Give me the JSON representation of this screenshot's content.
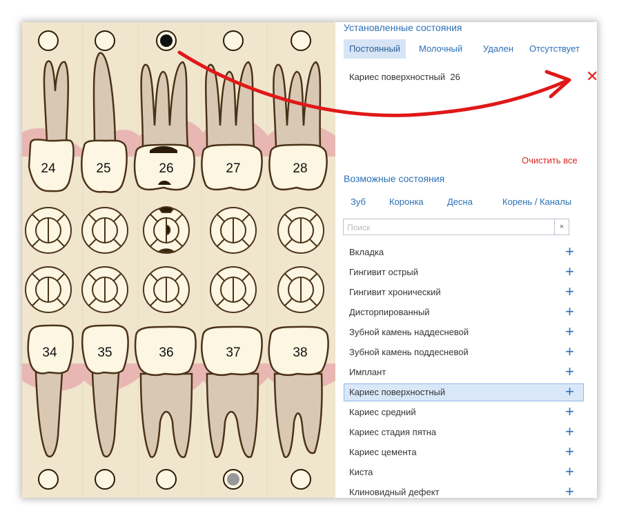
{
  "installed": {
    "title": "Установленные состояния",
    "tabs": [
      {
        "label": "Постоянный",
        "active": true
      },
      {
        "label": "Молочный",
        "active": false
      },
      {
        "label": "Удален",
        "active": false
      },
      {
        "label": "Отсутствует",
        "active": false
      }
    ],
    "conditions": [
      {
        "name": "Кариес поверхностный",
        "tooth": "26"
      }
    ],
    "clear_all_label": "Очистить все"
  },
  "possible": {
    "title": "Возможные состояния",
    "tabs": [
      {
        "label": "Зуб"
      },
      {
        "label": "Коронка"
      },
      {
        "label": "Десна"
      },
      {
        "label": "Корень / Каналы"
      }
    ],
    "search_placeholder": "Поиск",
    "search_clear_label": "×",
    "items": [
      {
        "label": "Вкладка",
        "selected": false
      },
      {
        "label": "Гингивит острый",
        "selected": false
      },
      {
        "label": "Гингивит хронический",
        "selected": false
      },
      {
        "label": "Дисторпированный",
        "selected": false
      },
      {
        "label": "Зубной камень наддесневой",
        "selected": false
      },
      {
        "label": "Зубной камень поддесневой",
        "selected": false
      },
      {
        "label": "Имплант",
        "selected": false
      },
      {
        "label": "Кариес поверхностный",
        "selected": true
      },
      {
        "label": "Кариес средний",
        "selected": false
      },
      {
        "label": "Кариес стадия пятна",
        "selected": false
      },
      {
        "label": "Кариес цемента",
        "selected": false
      },
      {
        "label": "Киста",
        "selected": false
      },
      {
        "label": "Клиновидный дефект",
        "selected": false
      }
    ],
    "add_icon": "plus-icon"
  },
  "chart": {
    "upper_teeth": [
      "24",
      "25",
      "26",
      "27",
      "28"
    ],
    "lower_teeth": [
      "34",
      "35",
      "36",
      "37",
      "38"
    ],
    "selected_tooth": "26",
    "colors": {
      "background": "#f0e5cd",
      "gum": "#e8b7b3",
      "crown": "#fcf6e2",
      "root": "#d8c8b4",
      "outline": "#4a3218",
      "caries": "#2a1a08",
      "arrow": "#e01818",
      "accent": "#2b6fb6"
    }
  }
}
